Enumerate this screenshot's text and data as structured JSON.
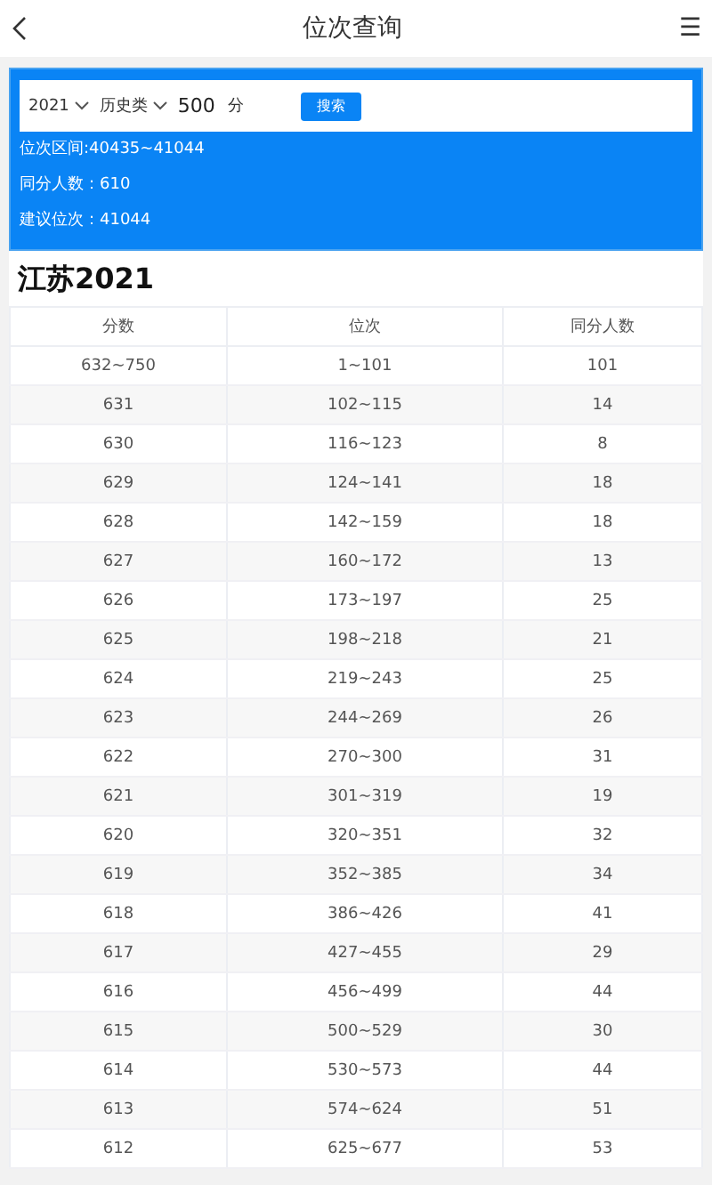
{
  "header": {
    "title": "位次查询",
    "menu": "☰"
  },
  "search": {
    "year": "2021",
    "category": "历史类",
    "score": "500",
    "unit": "分",
    "button": "搜索"
  },
  "results": [
    "位次区间:40435~41044",
    "同分人数：610",
    "建议位次：41044"
  ],
  "table": {
    "title": "江苏2021",
    "columns": [
      "分数",
      "位次",
      "同分人数"
    ],
    "rows": [
      [
        "632~750",
        "1~101",
        "101"
      ],
      [
        "631",
        "102~115",
        "14"
      ],
      [
        "630",
        "116~123",
        "8"
      ],
      [
        "629",
        "124~141",
        "18"
      ],
      [
        "628",
        "142~159",
        "18"
      ],
      [
        "627",
        "160~172",
        "13"
      ],
      [
        "626",
        "173~197",
        "25"
      ],
      [
        "625",
        "198~218",
        "21"
      ],
      [
        "624",
        "219~243",
        "25"
      ],
      [
        "623",
        "244~269",
        "26"
      ],
      [
        "622",
        "270~300",
        "31"
      ],
      [
        "621",
        "301~319",
        "19"
      ],
      [
        "620",
        "320~351",
        "32"
      ],
      [
        "619",
        "352~385",
        "34"
      ],
      [
        "618",
        "386~426",
        "41"
      ],
      [
        "617",
        "427~455",
        "29"
      ],
      [
        "616",
        "456~499",
        "44"
      ],
      [
        "615",
        "500~529",
        "30"
      ],
      [
        "614",
        "530~573",
        "44"
      ],
      [
        "613",
        "574~624",
        "51"
      ],
      [
        "612",
        "625~677",
        "53"
      ]
    ]
  }
}
